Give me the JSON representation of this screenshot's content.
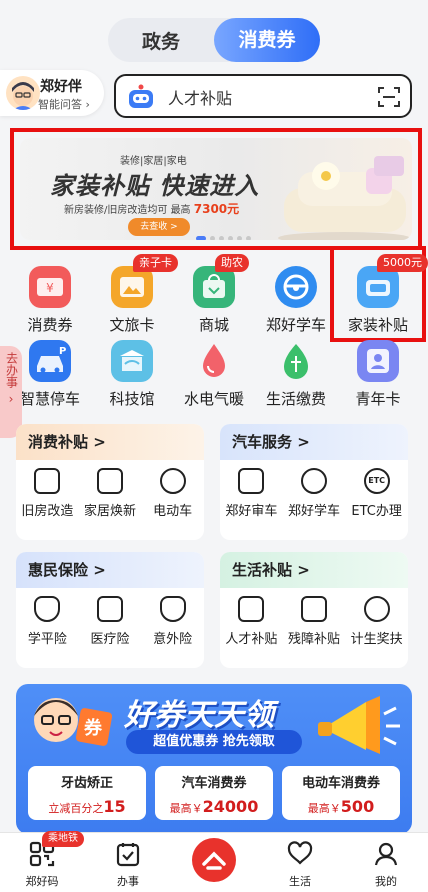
{
  "tabs": [
    {
      "label": "政务",
      "active": false
    },
    {
      "label": "消费券",
      "active": true
    }
  ],
  "assistant": {
    "name": "郑好伴",
    "subtitle": "智能问答"
  },
  "search": {
    "placeholder": "人才补贴"
  },
  "banner": {
    "category": "装修|家居|家电",
    "title": "家装补贴  快速进入",
    "desc": "新房装修/旧房改造均可",
    "highlight_prefix": "最高",
    "highlight_value": "7300元",
    "button": "去查收 >"
  },
  "grid": [
    {
      "label": "消费券",
      "tag": "",
      "icon": "coupon-icon",
      "color": "#f25b5b"
    },
    {
      "label": "文旅卡",
      "tag": "亲子卡",
      "icon": "mountain-card-icon",
      "color": "#f4a62a"
    },
    {
      "label": "商城",
      "tag": "助农",
      "icon": "shopping-bag-icon",
      "color": "#36b57a"
    },
    {
      "label": "郑好学车",
      "tag": "",
      "icon": "steering-wheel-icon",
      "color": "#2f8cf0"
    },
    {
      "label": "家装补贴",
      "tag": "5000元",
      "icon": "sofa-icon",
      "color": "#4aa6f5"
    },
    {
      "label": "智慧停车",
      "tag": "",
      "icon": "parking-car-icon",
      "color": "#2f78f0"
    },
    {
      "label": "科技馆",
      "tag": "",
      "icon": "science-museum-icon",
      "color": "#5dc0e6"
    },
    {
      "label": "水电气暖",
      "tag": "",
      "icon": "water-drop-icon",
      "color": "#f2626a"
    },
    {
      "label": "生活缴费",
      "tag": "",
      "icon": "leaf-payment-icon",
      "color": "#3bbf6b"
    },
    {
      "label": "青年卡",
      "tag": "",
      "icon": "youth-card-icon",
      "color": "#7a86f2"
    }
  ],
  "side_tab": {
    "text": "去办事"
  },
  "cards": [
    {
      "title": "消费补贴 >",
      "bg": "#fbe7d2",
      "items": [
        "旧房改造",
        "家居焕新",
        "电动车"
      ],
      "icons": [
        "house-brush-icon",
        "furniture-icon",
        "scooter-icon"
      ]
    },
    {
      "title": "汽车服务 >",
      "bg": "#dfe9fb",
      "items": [
        "郑好审车",
        "郑好学车",
        "ETC办理"
      ],
      "icons": [
        "car-inspection-icon",
        "steering-wheel-icon",
        "etc-icon"
      ]
    },
    {
      "title": "惠民保险 >",
      "bg": "#dbe6fb",
      "items": [
        "学平险",
        "医疗险",
        "意外险"
      ],
      "icons": [
        "student-insurance-icon",
        "medical-insurance-icon",
        "accident-insurance-icon"
      ]
    },
    {
      "title": "生活补贴 >",
      "bg": "#dcf3e6",
      "items": [
        "人才补贴",
        "残障补贴",
        "计生奖扶"
      ],
      "icons": [
        "talent-badge-icon",
        "disability-subsidy-icon",
        "family-planning-icon"
      ]
    }
  ],
  "promo": {
    "title": "好券天天领",
    "subtitle": "超值优惠券 抢先领取",
    "badge": "券",
    "coupons": [
      {
        "title": "牙齿矫正",
        "prefix": "立减百分之",
        "value": "15"
      },
      {
        "title": "汽车消费券",
        "prefix": "最高￥",
        "value": "24000"
      },
      {
        "title": "电动车消费券",
        "prefix": "最高￥",
        "value": "500"
      }
    ]
  },
  "tabbar": [
    {
      "label": "郑好码",
      "icon": "qr-code-icon",
      "badge": "乘地铁"
    },
    {
      "label": "办事",
      "icon": "clipboard-icon",
      "badge": ""
    },
    {
      "label": "生活",
      "icon": "heart-chat-icon",
      "badge": ""
    },
    {
      "label": "我的",
      "icon": "person-icon",
      "badge": ""
    }
  ]
}
